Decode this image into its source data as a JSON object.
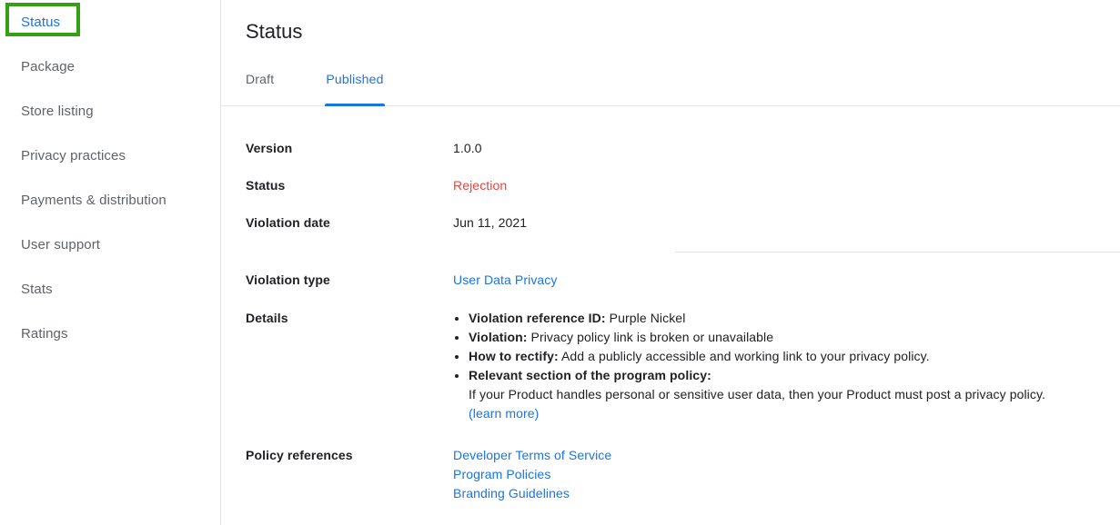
{
  "sidebar": {
    "items": [
      {
        "label": "Status",
        "active": true,
        "highlighted": true
      },
      {
        "label": "Package",
        "active": false,
        "highlighted": false
      },
      {
        "label": "Store listing",
        "active": false,
        "highlighted": false
      },
      {
        "label": "Privacy practices",
        "active": false,
        "highlighted": false
      },
      {
        "label": "Payments & distribution",
        "active": false,
        "highlighted": false
      },
      {
        "label": "User support",
        "active": false,
        "highlighted": false
      },
      {
        "label": "Stats",
        "active": false,
        "highlighted": false
      },
      {
        "label": "Ratings",
        "active": false,
        "highlighted": false
      }
    ],
    "highlight_color": "#34a014"
  },
  "main": {
    "title": "Status",
    "tabs": [
      {
        "label": "Draft",
        "active": false
      },
      {
        "label": "Published",
        "active": true
      }
    ],
    "fields": {
      "version_label": "Version",
      "version_value": "1.0.0",
      "status_label": "Status",
      "status_value": "Rejection",
      "status_color": "#e8453c",
      "violation_date_label": "Violation date",
      "violation_date_value": "Jun 11, 2021",
      "violation_type_label": "Violation type",
      "violation_type_value": "User Data Privacy",
      "details_label": "Details",
      "policy_references_label": "Policy references"
    },
    "details": [
      {
        "term": "Violation reference ID:",
        "text": " Purple Nickel"
      },
      {
        "term": "Violation:",
        "text": " Privacy policy link is broken or unavailable"
      },
      {
        "term": "How to rectify:",
        "text": " Add a publicly accessible and working link to your privacy policy."
      },
      {
        "term": "Relevant section of the program policy:",
        "text": ""
      }
    ],
    "relevant_section_paragraph": "If your Product handles personal or sensitive user data, then your Product must post a privacy policy.",
    "learn_more_label": "(learn more)",
    "policy_references": [
      "Developer Terms of Service",
      "Program Policies",
      "Branding Guidelines"
    ],
    "accent_color": "#1a73e8"
  }
}
